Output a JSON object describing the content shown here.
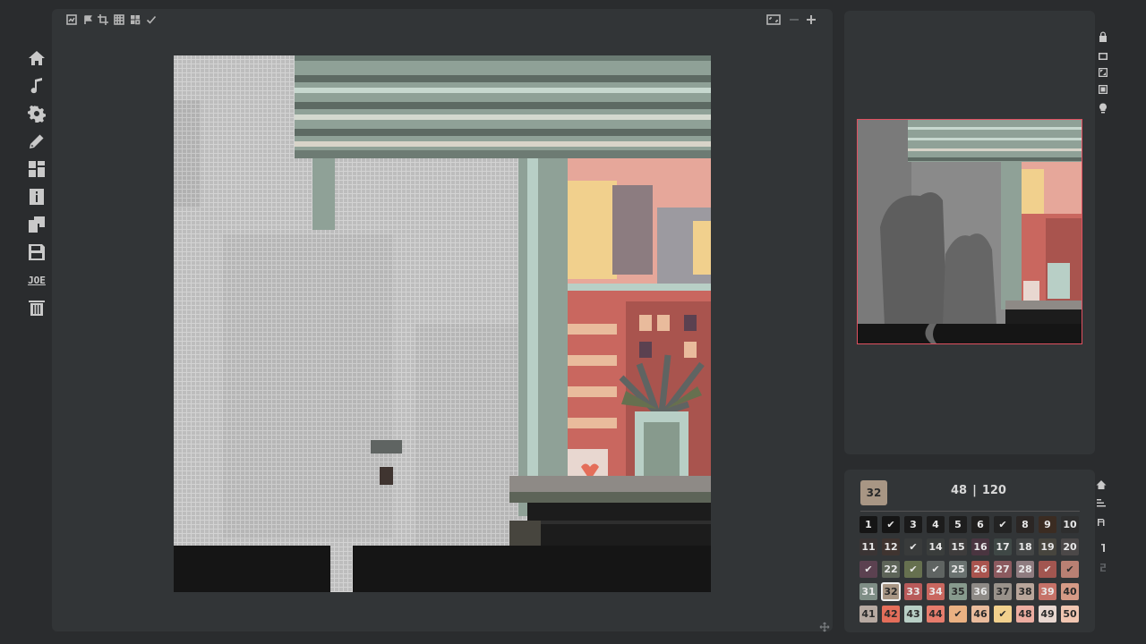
{
  "sidebar": {
    "items": [
      {
        "name": "home-icon"
      },
      {
        "name": "music-note-icon"
      },
      {
        "name": "gear-icon"
      },
      {
        "name": "pencil-icon"
      },
      {
        "name": "grid-icon"
      },
      {
        "name": "info-icon"
      },
      {
        "name": "gallery-icon"
      },
      {
        "name": "save-icon"
      },
      {
        "name": "user-label",
        "text": "JOE"
      },
      {
        "name": "trash-icon"
      }
    ]
  },
  "toolbar": {
    "left_tools": [
      "image-icon",
      "flag-icon",
      "crop-icon",
      "checker-icon",
      "layers-icon",
      "check-icon"
    ],
    "right_tools": [
      "fit-screen-icon",
      "zoom-out-icon",
      "zoom-in-icon"
    ]
  },
  "right_tools": [
    "lock-icon",
    "frame-icon",
    "expand-icon",
    "fullscreen-icon",
    "lightbulb-icon"
  ],
  "palette_tools": [
    "home-small-icon",
    "sort-icon",
    "text-size-icon",
    "number-one-icon",
    "number-two-icon"
  ],
  "palette": {
    "current": "32",
    "progress_done": "48",
    "progress_total": "120",
    "colors": {
      "1": "#151515",
      "2": "#151515",
      "3": "#1a1a1a",
      "4": "#1c1c1c",
      "5": "#1e1e1e",
      "6": "#201f1e",
      "7": "#232323",
      "8": "#2b2624",
      "9": "#3b2c22",
      "10": "#2e2e2e",
      "11": "#3a3434",
      "12": "#3f3430",
      "13": "#393b3b",
      "14": "#3a3d3c",
      "15": "#3e3c3c",
      "16": "#4a3540",
      "17": "#3f4846",
      "18": "#444646",
      "19": "#47453e",
      "20": "#4b4848",
      "21": "#5b4150",
      "22": "#5d6458",
      "23": "#66704f",
      "24": "#5f6462",
      "25": "#6a7270",
      "26": "#a9544e",
      "27": "#8c5a5f",
      "28": "#8f7c80",
      "29": "#a25650",
      "30": "#b98073",
      "31": "#7f8e86",
      "32": "#a89684",
      "33": "#b85a5a",
      "34": "#c9675f",
      "35": "#879a8d",
      "36": "#8e8a86",
      "37": "#99928a",
      "38": "#b8a59a",
      "39": "#c67268",
      "40": "#d59a86",
      "41": "#b7aaa2",
      "42": "#e46e5a",
      "43": "#b8cfc6",
      "44": "#e77c6c",
      "45": "#eab182",
      "46": "#e9bb9c",
      "47": "#f1d08d",
      "48": "#ecaca0",
      "49": "#e8d7d0",
      "50": "#f0c6b1"
    },
    "done": [
      "2",
      "7",
      "13",
      "21",
      "23",
      "24",
      "29",
      "30",
      "45",
      "47"
    ],
    "selected": "32"
  }
}
